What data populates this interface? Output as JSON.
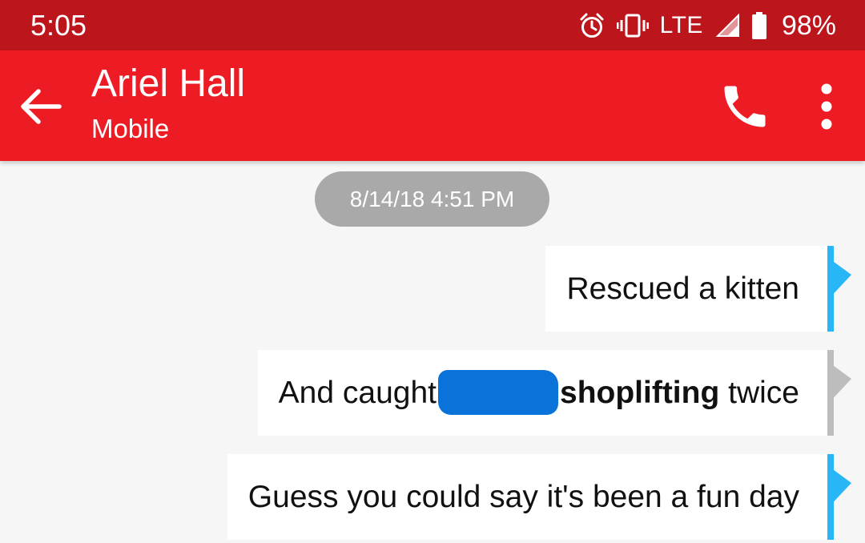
{
  "status_bar": {
    "time": "5:05",
    "network": "LTE",
    "battery": "98%",
    "icons": [
      "alarm-icon",
      "vibrate-icon",
      "signal-icon",
      "battery-icon"
    ]
  },
  "header": {
    "contact_name": "Ariel Hall",
    "contact_type": "Mobile",
    "icons": [
      "back-arrow-icon",
      "phone-icon",
      "more-vert-icon"
    ]
  },
  "conversation": {
    "timestamp": "8/14/18 4:51 PM",
    "messages": [
      {
        "text": "Rescued a kitten",
        "status_color": "#29b6f6"
      },
      {
        "text_before": "And caught",
        "text_bold": "shoplifting",
        "text_after": "twice",
        "redacted": true,
        "status_color": "#bdbdbd"
      },
      {
        "text": "Guess you could say it's been a fun day",
        "status_color": "#29b6f6"
      }
    ]
  },
  "colors": {
    "status_bar": "#bd151c",
    "app_bar": "#ed1c24",
    "redaction": "#0a73d9",
    "background": "#f6f6f6"
  }
}
